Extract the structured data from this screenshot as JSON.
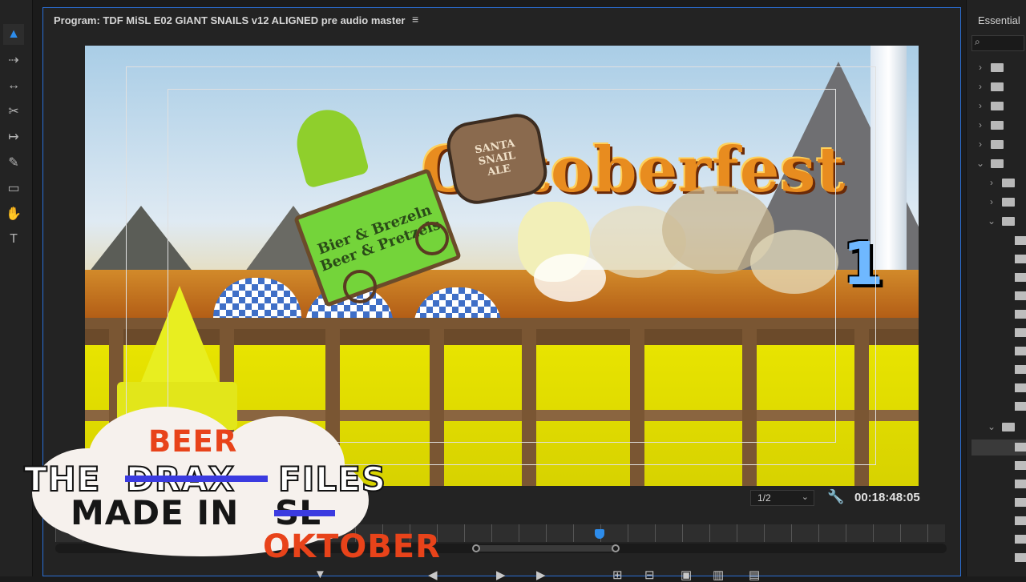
{
  "monitor": {
    "title": "Program: TDF MiSL E02 GIANT SNAILS v12 ALIGNED pre audio master",
    "menu_icon": "hamburger-menu-icon"
  },
  "video": {
    "sign_text": "Oktoberfest",
    "cart_text": "Bier & Brezeln\nBeer & Pretzels",
    "barrel_text": "SANTA\nSNAIL\nALE",
    "counter": "1"
  },
  "controls": {
    "zoom_value": "1/2",
    "timecode": "00:18:48:05"
  },
  "right_panel": {
    "title": "Essential"
  },
  "logo": {
    "beer": "BEER",
    "the": "THE",
    "drax": "DRAX",
    "files": "FILES",
    "made_in": "MADE IN",
    "num": "SL",
    "oktober": "OKTOBER"
  },
  "colors": {
    "accent": "#2d8ceb",
    "logo_red": "#e8431a",
    "logo_blue": "#3b3be0"
  }
}
